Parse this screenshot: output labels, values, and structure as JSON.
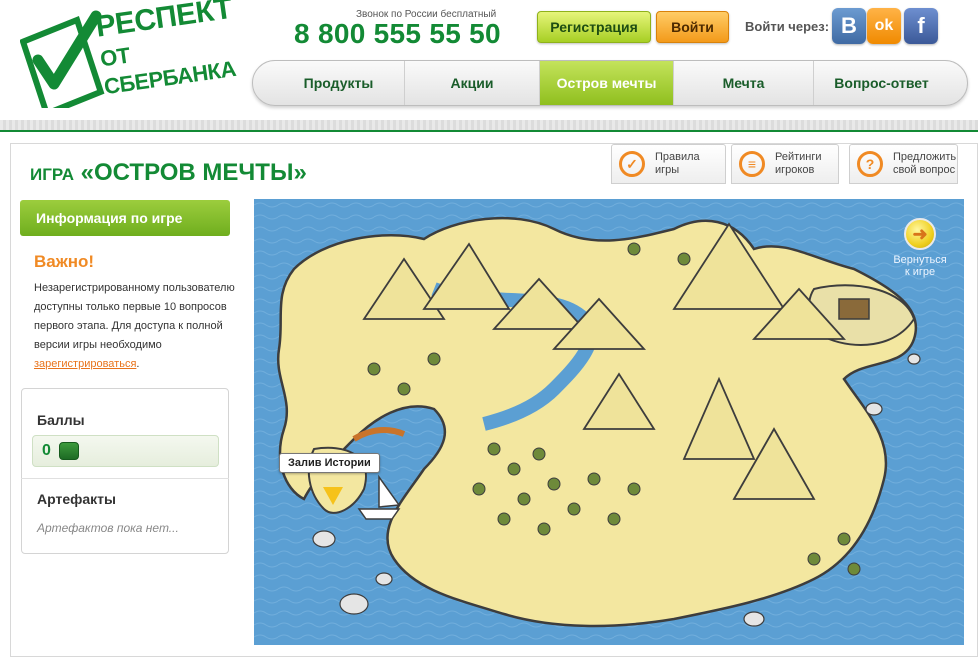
{
  "logo": {
    "line1": "РЕСПЕКТ",
    "line2": "ОТ СБЕРБАНКА"
  },
  "header": {
    "phone_note": "Звонок по России бесплатный",
    "phone": "8 800 555 55 50",
    "register_label": "Регистрация",
    "login_label": "Войти",
    "login_via": "Войти через:",
    "social": [
      "В",
      "ok",
      "f"
    ]
  },
  "nav": {
    "items": [
      {
        "label": "Продукты"
      },
      {
        "label": "Акции"
      },
      {
        "label": "Остров мечты",
        "active": true
      },
      {
        "label": "Мечта"
      },
      {
        "label": "Вопрос-ответ"
      }
    ]
  },
  "page": {
    "title_prefix": "ИГРА",
    "title": "«ОСТРОВ МЕЧТЫ»"
  },
  "tabs": [
    {
      "label": "Правила игры",
      "icon": "check-icon"
    },
    {
      "label": "Рейтинги игроков",
      "icon": "list-icon"
    },
    {
      "label": "Предложить свой вопрос",
      "icon": "question-icon"
    }
  ],
  "sidebar": {
    "info_button": "Информация по игре",
    "important": "Важно!",
    "info_text": "Незарегистрированному пользователю доступны только первые 10 вопросов первого этапа. Для доступа к полной версии игры необходимо",
    "info_link": "зарегистрироваться",
    "info_end": ".",
    "score_title": "Баллы",
    "score_value": "0",
    "artifacts_title": "Артефакты",
    "artifacts_empty": "Артефактов пока нет..."
  },
  "map": {
    "location_label": "Залив Истории",
    "back_label": "Вернуться к игре"
  },
  "colors": {
    "brand_green": "#138a35",
    "lime": "#8fbf1e",
    "orange": "#f08a24",
    "sea": "#5b9fd3",
    "sand": "#f3e7a0"
  }
}
